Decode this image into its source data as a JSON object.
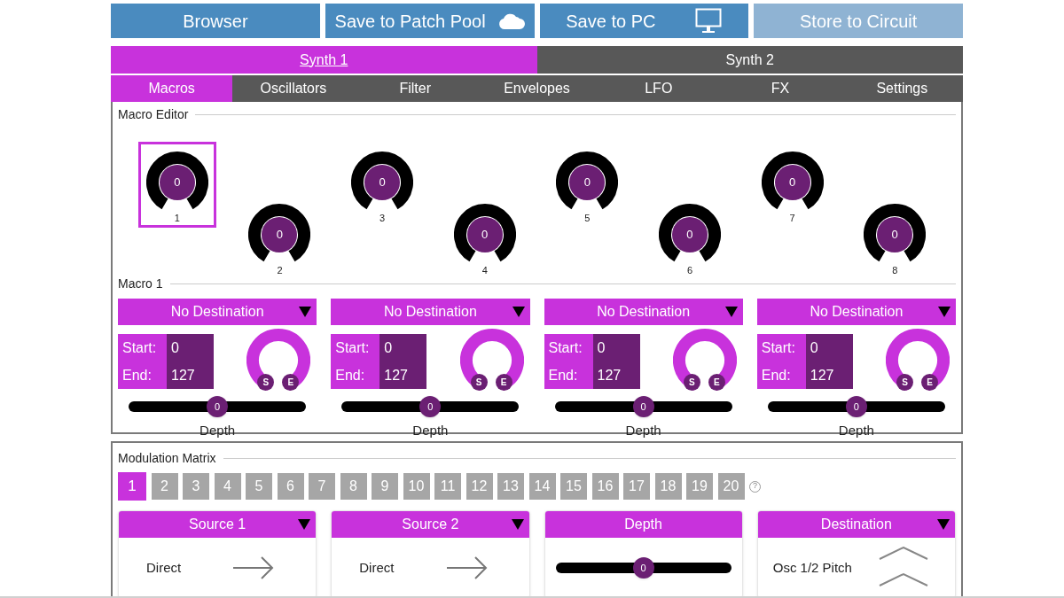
{
  "toolbar": [
    {
      "label": "Browser",
      "disabled": false
    },
    {
      "label": "Save to Patch Pool",
      "disabled": false
    },
    {
      "label": "Save to PC",
      "disabled": false
    },
    {
      "label": "Store to Circuit",
      "disabled": true
    }
  ],
  "synth_tabs": [
    {
      "label": "Synth 1",
      "selected": true
    },
    {
      "label": "Synth 2",
      "selected": false
    }
  ],
  "section_tabs": [
    {
      "label": "Macros",
      "selected": true
    },
    {
      "label": "Oscillators",
      "selected": false
    },
    {
      "label": "Filter",
      "selected": false
    },
    {
      "label": "Envelopes",
      "selected": false
    },
    {
      "label": "LFO",
      "selected": false
    },
    {
      "label": "FX",
      "selected": false
    },
    {
      "label": "Settings",
      "selected": false
    }
  ],
  "macro_editor": {
    "title": "Macro Editor",
    "knobs": [
      {
        "number": "1",
        "value": "0",
        "selected": true
      },
      {
        "number": "2",
        "value": "0",
        "selected": false
      },
      {
        "number": "3",
        "value": "0",
        "selected": false
      },
      {
        "number": "4",
        "value": "0",
        "selected": false
      },
      {
        "number": "5",
        "value": "0",
        "selected": false
      },
      {
        "number": "6",
        "value": "0",
        "selected": false
      },
      {
        "number": "7",
        "value": "0",
        "selected": false
      },
      {
        "number": "8",
        "value": "0",
        "selected": false
      }
    ]
  },
  "macro": {
    "title": "Macro 1",
    "slots": [
      {
        "destination": "No Destination",
        "start_label": "Start:",
        "start": "0",
        "end_label": "End:",
        "end": "127",
        "start_handle": "S",
        "end_handle": "E",
        "depth_value": "0",
        "level": 0.5,
        "depth_label": "Depth"
      },
      {
        "destination": "No Destination",
        "start_label": "Start:",
        "start": "0",
        "end_label": "End:",
        "end": "127",
        "start_handle": "S",
        "end_handle": "E",
        "depth_value": "0",
        "level": 0.5,
        "depth_label": "Depth"
      },
      {
        "destination": "No Destination",
        "start_label": "Start:",
        "start": "0",
        "end_label": "End:",
        "end": "127",
        "start_handle": "S",
        "end_handle": "E",
        "depth_value": "0",
        "level": 0.5,
        "depth_label": "Depth"
      },
      {
        "destination": "No Destination",
        "start_label": "Start:",
        "start": "0",
        "end_label": "End:",
        "end": "127",
        "start_handle": "S",
        "end_handle": "E",
        "depth_value": "0",
        "level": 0.5,
        "depth_label": "Depth"
      }
    ]
  },
  "mod_matrix": {
    "title": "Modulation Matrix",
    "help": "?",
    "slots": [
      {
        "label": "1",
        "selected": true
      },
      {
        "label": "2",
        "selected": false
      },
      {
        "label": "3",
        "selected": false
      },
      {
        "label": "4",
        "selected": false
      },
      {
        "label": "5",
        "selected": false
      },
      {
        "label": "6",
        "selected": false
      },
      {
        "label": "7",
        "selected": false
      },
      {
        "label": "8",
        "selected": false
      },
      {
        "label": "9",
        "selected": false
      },
      {
        "label": "10",
        "selected": false
      },
      {
        "label": "11",
        "selected": false
      },
      {
        "label": "12",
        "selected": false
      },
      {
        "label": "13",
        "selected": false
      },
      {
        "label": "14",
        "selected": false
      },
      {
        "label": "15",
        "selected": false
      },
      {
        "label": "16",
        "selected": false
      },
      {
        "label": "17",
        "selected": false
      },
      {
        "label": "18",
        "selected": false
      },
      {
        "label": "19",
        "selected": false
      },
      {
        "label": "20",
        "selected": false
      }
    ],
    "cards": [
      {
        "kind": "source",
        "header": "Source 1",
        "value": "Direct"
      },
      {
        "kind": "source",
        "header": "Source 2",
        "value": "Direct"
      },
      {
        "kind": "depth",
        "header": "Depth",
        "value": "0",
        "level": 0.5
      },
      {
        "kind": "destination",
        "header": "Destination",
        "value": "Osc 1/2 Pitch"
      }
    ]
  }
}
